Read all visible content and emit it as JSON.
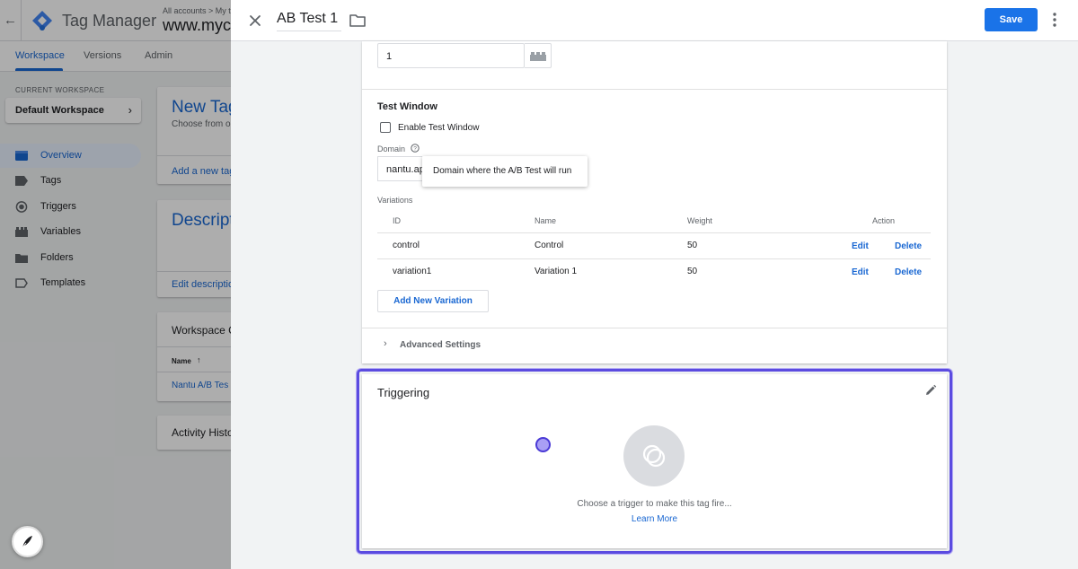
{
  "app": {
    "name": "Tag Manager",
    "breadcrumb": "All accounts  >  My t",
    "container": "www.myco"
  },
  "tabs": [
    {
      "label": "Workspace",
      "active": true
    },
    {
      "label": "Versions",
      "active": false
    },
    {
      "label": "Admin",
      "active": false
    }
  ],
  "workspace": {
    "current_label": "CURRENT WORKSPACE",
    "name": "Default Workspace"
  },
  "sidebar": {
    "items": [
      {
        "label": "Overview",
        "icon": "overview-icon",
        "active": true
      },
      {
        "label": "Tags",
        "icon": "tag-icon",
        "active": false
      },
      {
        "label": "Triggers",
        "icon": "trigger-icon",
        "active": false
      },
      {
        "label": "Variables",
        "icon": "variables-icon",
        "active": false
      },
      {
        "label": "Folders",
        "icon": "folder-icon",
        "active": false
      },
      {
        "label": "Templates",
        "icon": "template-icon",
        "active": false
      }
    ]
  },
  "bg_cards": {
    "new_tag_title": "New Tag",
    "new_tag_sub": "Choose from o",
    "new_tag_link": "Add a new tag",
    "description_title": "Descripti",
    "description_link": "Edit descriptio",
    "changes_title": "Workspace C",
    "changes_col": "Name",
    "changes_row": "Nantu A/B Tes",
    "activity_title": "Activity Histo"
  },
  "panel": {
    "tag_name": "AB Test 1",
    "save_label": "Save"
  },
  "config": {
    "number_value": "1",
    "test_window_title": "Test Window",
    "enable_label": "Enable Test Window",
    "enable_checked": false,
    "domain_label": "Domain",
    "domain_value": "nantu.app",
    "domain_tooltip": "Domain where the A/B Test will run",
    "variations_label": "Variations",
    "columns": {
      "id": "ID",
      "name": "Name",
      "weight": "Weight",
      "action": "Action"
    },
    "variations": [
      {
        "id": "control",
        "name": "Control",
        "weight": "50",
        "edit": "Edit",
        "delete": "Delete"
      },
      {
        "id": "variation1",
        "name": "Variation 1",
        "weight": "50",
        "edit": "Edit",
        "delete": "Delete"
      }
    ],
    "add_variation": "Add New Variation",
    "advanced": "Advanced Settings"
  },
  "triggering": {
    "title": "Triggering",
    "hint": "Choose a trigger to make this tag fire...",
    "learn_more": "Learn More"
  },
  "colors": {
    "accent": "#1a73e8",
    "link": "#1967d2",
    "focus_outline": "#5b4be0"
  }
}
